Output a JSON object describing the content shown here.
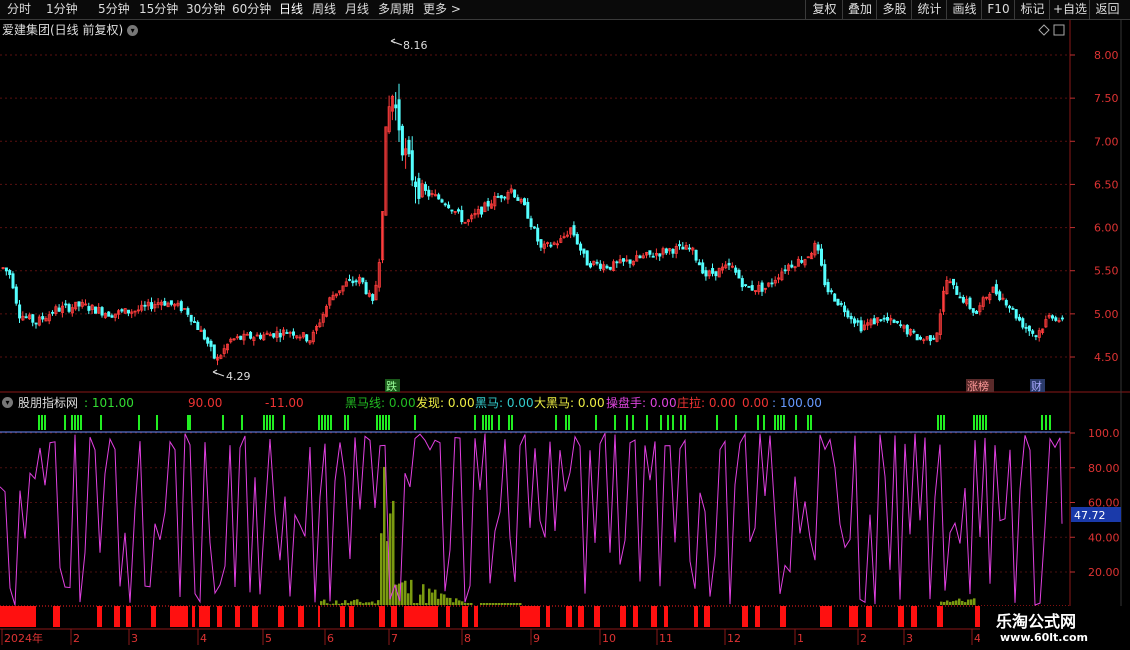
{
  "toolbar": {
    "periods": [
      "分时",
      "1分钟",
      "5分钟",
      "15分钟",
      "30分钟",
      "60分钟",
      "日线",
      "周线",
      "月线",
      "多周期",
      "更多 >"
    ],
    "active_period": "日线",
    "actions": [
      "复权",
      "叠加",
      "多股",
      "统计",
      "画线",
      "F10",
      "标记",
      "+自选",
      "返回"
    ]
  },
  "main_title": "爱建集团(日线 前复权)",
  "price_panel": {
    "axis_labels": [
      "8.00",
      "7.50",
      "7.00",
      "6.50",
      "6.00",
      "5.50",
      "5.00",
      "4.50"
    ],
    "high_label": "8.16",
    "low_label": "4.29",
    "event_markers": [
      "跌",
      "涨榜",
      "财"
    ]
  },
  "indicator_panel": {
    "name": "股朋指标网",
    "values": [
      {
        "text": ": 101.00",
        "color": "#33dd33"
      },
      {
        "text": "90.00",
        "color": "#ee3333"
      },
      {
        "text": "-11.00",
        "color": "#ee3333"
      },
      {
        "text": "黑马线: 0.00",
        "color": "#22bb22"
      },
      {
        "text": "发现: 0.00",
        "color": "#eeee44"
      },
      {
        "text": "黑马: 0.00",
        "color": "#33cccc"
      },
      {
        "text": "大黑马: 0.00",
        "color": "#eeee44"
      },
      {
        "text": "操盘手: 0.00",
        "color": "#dd44dd"
      },
      {
        "text": "庄拉: 0.00",
        "color": "#ee3333"
      },
      {
        "text": "0.00",
        "color": "#ee3333"
      },
      {
        "text": ": 100.00",
        "color": "#6699ff"
      }
    ],
    "axis_labels": [
      "100.0",
      "80.00",
      "60.00",
      "40.00",
      "20.00"
    ],
    "current_value": "47.72"
  },
  "time_axis": [
    "2024年",
    "2",
    "3",
    "4",
    "5",
    "6",
    "7",
    "8",
    "9",
    "10",
    "11",
    "12",
    "1",
    "2",
    "3",
    "4"
  ],
  "watermark": {
    "line1": "乐淘公式网",
    "line2": "www.60lt.com"
  },
  "chart_data": {
    "type": "candlestick",
    "price_high": 8.16,
    "price_low": 4.29,
    "price_axis_ticks": [
      4.5,
      5.0,
      5.5,
      6.0,
      6.5,
      7.0,
      7.5,
      8.0
    ],
    "indicator_axis_ticks": [
      20,
      40,
      60,
      80,
      100
    ],
    "indicator_current": 47.72,
    "colors": {
      "up": "#ff3c3c",
      "down": "#54ffff",
      "purple": "#e040e0",
      "signal_green": "#22ee22",
      "hline": "#6a8cff",
      "volume": "#7a9a10",
      "red_bar": "#ff1010"
    }
  }
}
